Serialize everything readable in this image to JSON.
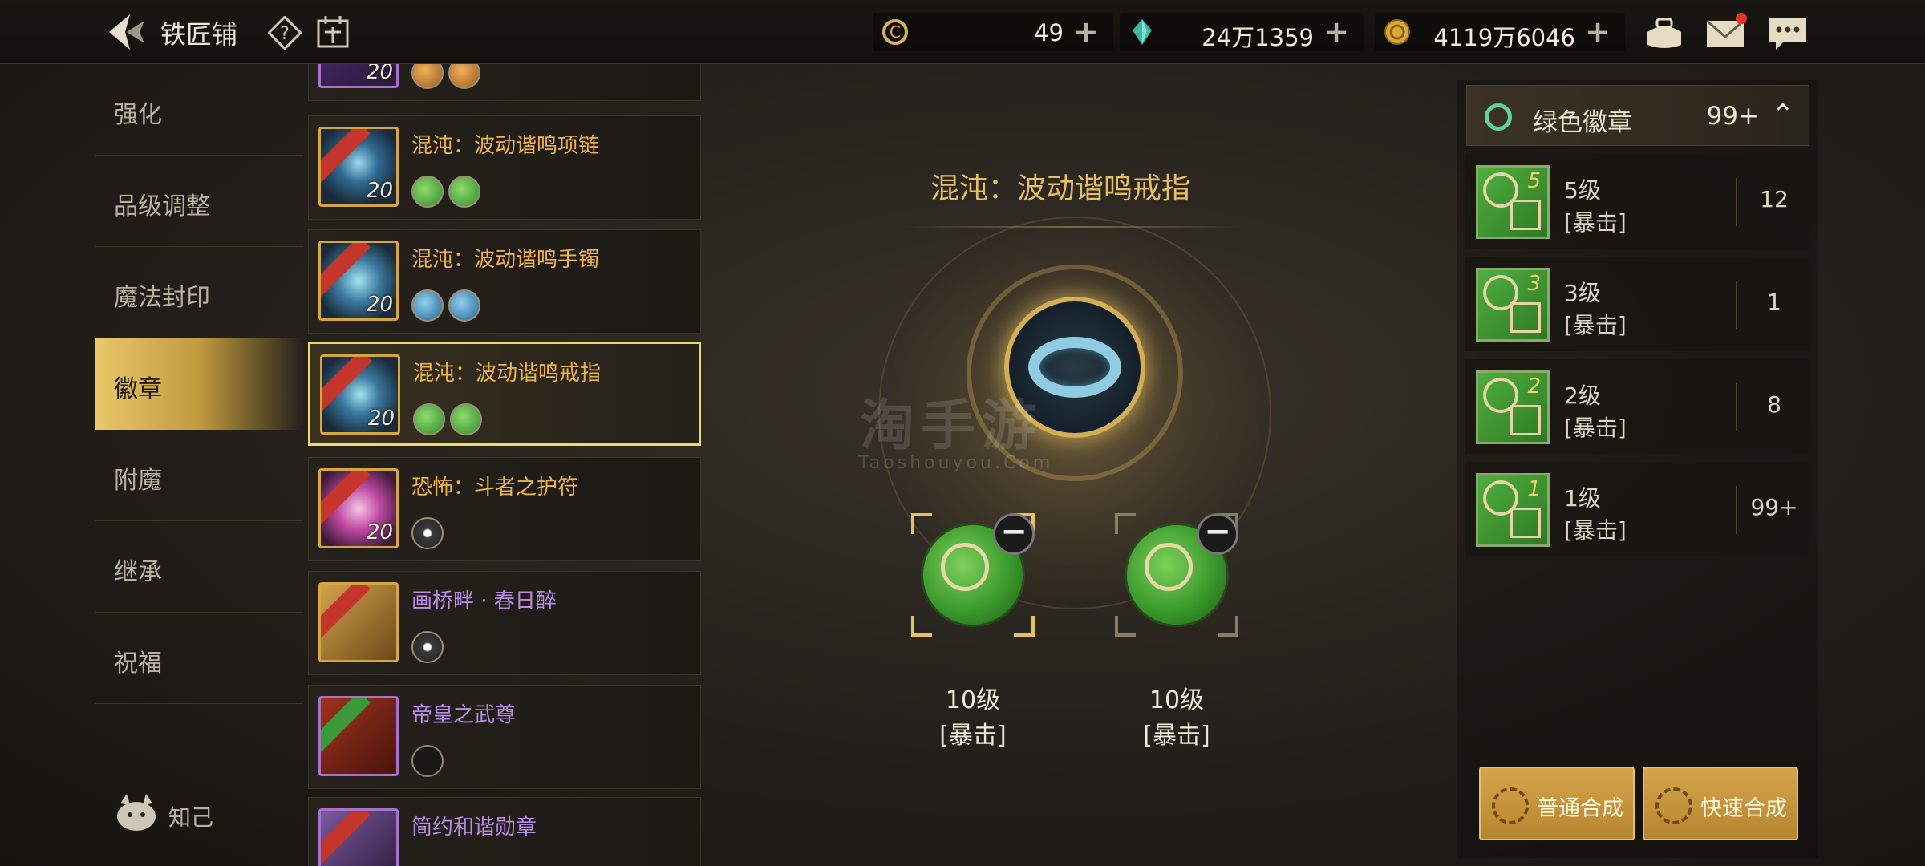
{
  "header": {
    "title": "铁匠铺",
    "currencies": [
      {
        "icon": "c-coin-icon",
        "value": "49"
      },
      {
        "icon": "crystal-icon",
        "value": "24万1359"
      },
      {
        "icon": "gold-coin-icon",
        "value": "4119万6046"
      }
    ],
    "plus": "+"
  },
  "nav": {
    "items": [
      {
        "label": "强化",
        "active": false
      },
      {
        "label": "品级调整",
        "active": false
      },
      {
        "label": "魔法封印",
        "active": false
      },
      {
        "label": "徽章",
        "active": true
      },
      {
        "label": "附魔",
        "active": false
      },
      {
        "label": "继承",
        "active": false
      },
      {
        "label": "祝福",
        "active": false
      }
    ],
    "wise_label": "知己"
  },
  "list": {
    "items": [
      {
        "name": "",
        "level": "20",
        "slots": [
          "orange",
          "orange"
        ],
        "border": "gold"
      },
      {
        "name": "混沌：波动谐鸣项链",
        "level": "20",
        "slots": [
          "green",
          "green"
        ],
        "border": "gold"
      },
      {
        "name": "混沌：波动谐鸣手镯",
        "level": "20",
        "slots": [
          "blue",
          "blue"
        ],
        "border": "gold"
      },
      {
        "name": "混沌：波动谐鸣戒指",
        "level": "20",
        "slots": [
          "green",
          "green"
        ],
        "border": "gold",
        "selected": true
      },
      {
        "name": "恐怖：斗者之护符",
        "level": "20",
        "slots": [
          "white"
        ],
        "border": "gold"
      },
      {
        "name": "画桥畔 · 春日醉",
        "level": "",
        "slots": [
          "white"
        ],
        "border": "gold"
      },
      {
        "name": "帝皇之武尊",
        "level": "",
        "slots": [
          "empty"
        ],
        "border": "purple"
      },
      {
        "name": "简约和谐勋章",
        "level": "",
        "slots": [],
        "border": "purple"
      }
    ]
  },
  "center": {
    "title": "混沌：波动谐鸣戒指",
    "watermark": "淘手游",
    "watermark_sub": "Taoshouyou.Com",
    "minus": "−",
    "sockets": [
      {
        "level": "10级",
        "type": "[暴击]"
      },
      {
        "level": "10级",
        "type": "[暴击]"
      }
    ]
  },
  "right": {
    "header": {
      "label": "绿色徽章",
      "count": "99+",
      "chevron": "⌃"
    },
    "items": [
      {
        "num": "5",
        "level": "5级",
        "type": "[暴击]",
        "qty": "12"
      },
      {
        "num": "3",
        "level": "3级",
        "type": "[暴击]",
        "qty": "1"
      },
      {
        "num": "2",
        "level": "2级",
        "type": "[暴击]",
        "qty": "8"
      },
      {
        "num": "1",
        "level": "1级",
        "type": "[暴击]",
        "qty": "99+"
      }
    ],
    "buttons": {
      "normal": "普通合成",
      "quick": "快速合成"
    }
  }
}
